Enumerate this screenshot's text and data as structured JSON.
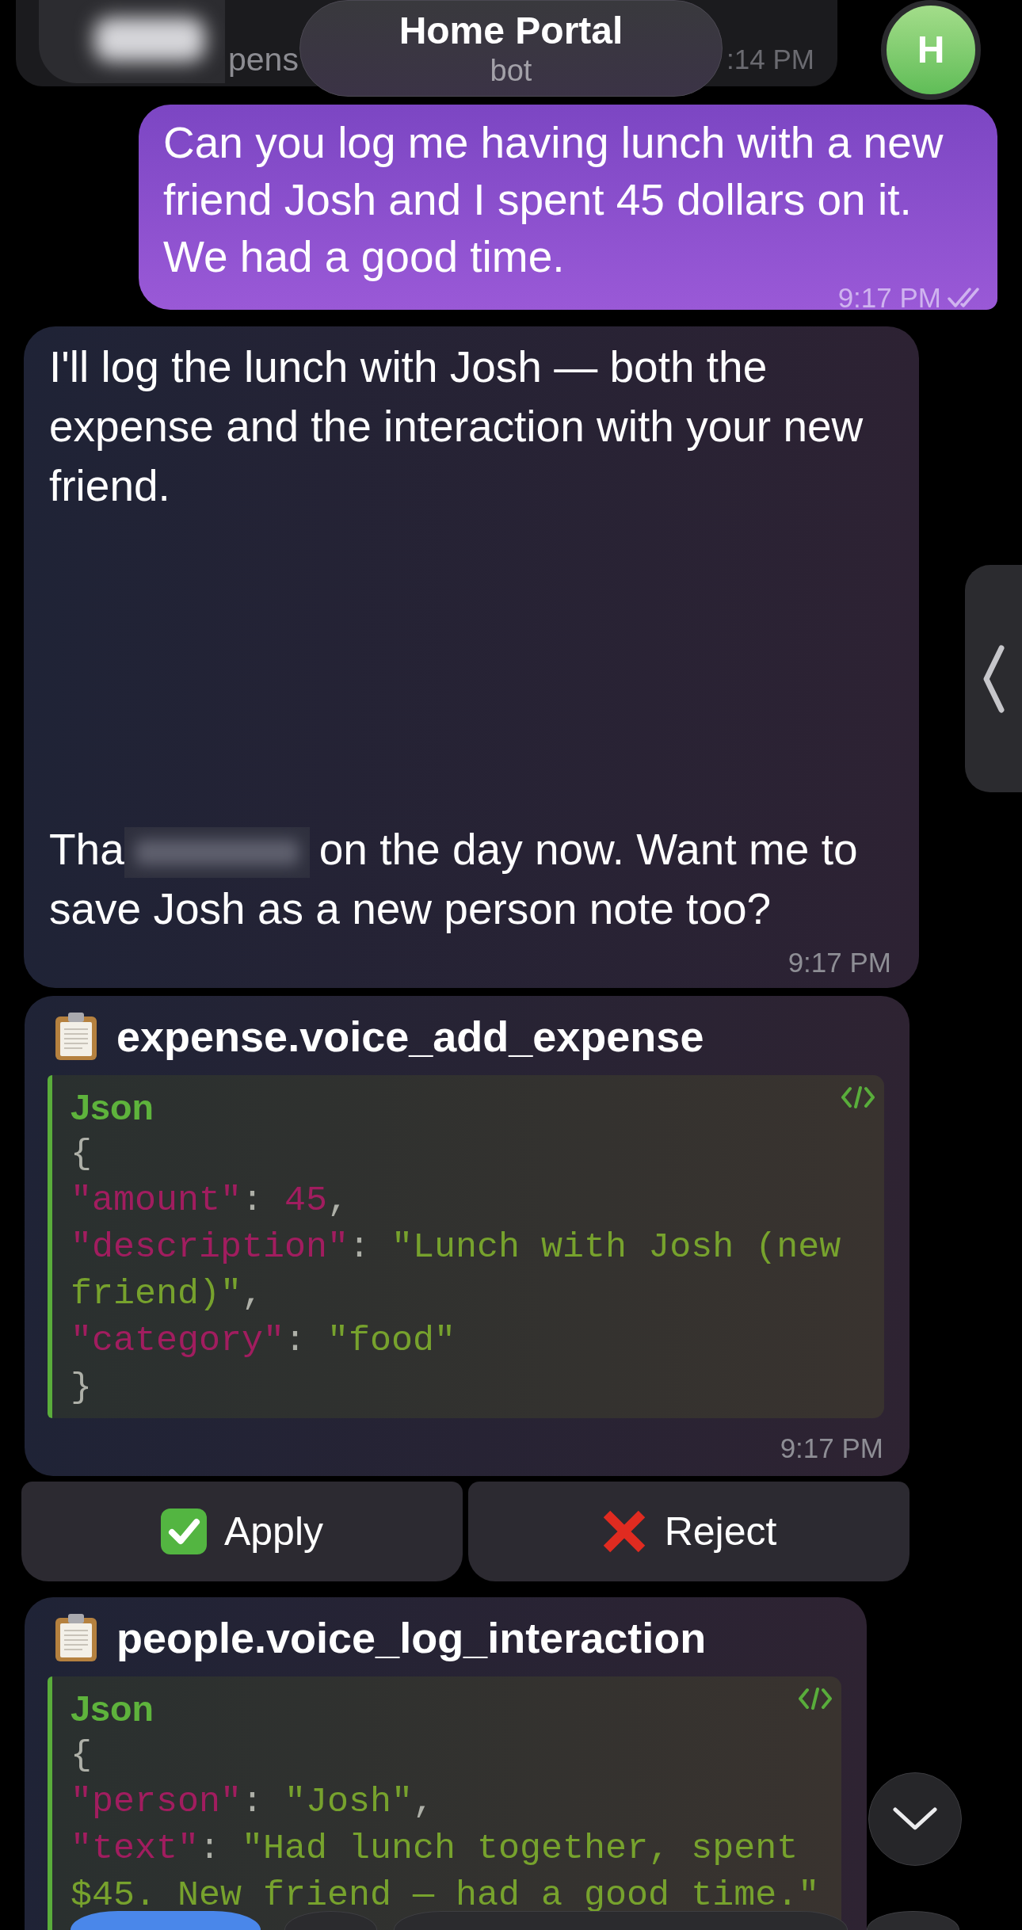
{
  "header": {
    "title": "Home Portal",
    "subtitle": "bot"
  },
  "avatar": {
    "letter": "H"
  },
  "previous_message": {
    "text": "pens",
    "time": ":14 PM"
  },
  "messages": [
    {
      "kind": "outgoing",
      "text": "Can you log me having lunch with a new friend Josh and I spent 45 dollars on it. We had a good time.",
      "time": "9:17 PM",
      "read": true
    },
    {
      "kind": "incoming",
      "paragraphs": [
        {
          "segments": [
            {
              "kind": "text",
              "text": "I'll log the lunch with Josh — both the expense and the interaction with your new friend."
            }
          ]
        },
        {
          "segments": [
            {
              "kind": "text",
              "text": "Tha"
            },
            {
              "kind": "blur"
            },
            {
              "kind": "text",
              "text": "on the day now. Want me to save Josh as a new person note too?"
            }
          ]
        }
      ],
      "time": "9:17 PM"
    },
    {
      "kind": "tool_call",
      "title": "expense.voice_add_expense",
      "code": {
        "language": "Json",
        "lines": [
          {
            "tokens": [
              {
                "kind": "punct",
                "text": "{"
              }
            ]
          },
          {
            "tokens": [
              {
                "kind": "key",
                "text": "\"amount\""
              },
              {
                "kind": "punct",
                "text": ": "
              },
              {
                "kind": "number",
                "text": "45"
              },
              {
                "kind": "punct",
                "text": ","
              }
            ]
          },
          {
            "tokens": [
              {
                "kind": "key",
                "text": "\"description\""
              },
              {
                "kind": "punct",
                "text": ": "
              },
              {
                "kind": "string",
                "text": "\"Lunch with Josh (new friend)\""
              },
              {
                "kind": "punct",
                "text": ","
              }
            ]
          },
          {
            "tokens": [
              {
                "kind": "key",
                "text": "\"category\""
              },
              {
                "kind": "punct",
                "text": ": "
              },
              {
                "kind": "string",
                "text": "\"food\""
              }
            ]
          },
          {
            "tokens": [
              {
                "kind": "punct",
                "text": "}"
              }
            ]
          }
        ]
      },
      "time": "9:17 PM"
    },
    {
      "kind": "buttons",
      "buttons": [
        {
          "kind": "apply",
          "label": "Apply"
        },
        {
          "kind": "reject",
          "label": "Reject"
        }
      ]
    },
    {
      "kind": "tool_call",
      "title": "people.voice_log_interaction",
      "code": {
        "language": "Json",
        "lines": [
          {
            "tokens": [
              {
                "kind": "punct",
                "text": "{"
              }
            ]
          },
          {
            "tokens": [
              {
                "kind": "key",
                "text": "\"person\""
              },
              {
                "kind": "punct",
                "text": ": "
              },
              {
                "kind": "string",
                "text": "\"Josh\""
              },
              {
                "kind": "punct",
                "text": ","
              }
            ]
          },
          {
            "tokens": [
              {
                "kind": "key",
                "text": "\"text\""
              },
              {
                "kind": "punct",
                "text": ": "
              },
              {
                "kind": "string",
                "text": "\"Had lunch together, spent $45. New friend — had a good time.\""
              }
            ]
          }
        ]
      }
    }
  ]
}
